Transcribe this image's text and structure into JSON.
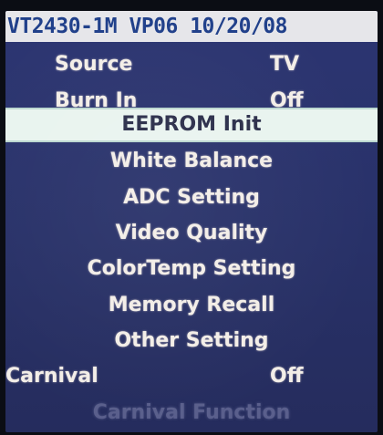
{
  "header": {
    "title": "VT2430-1M VP06 10/20/08"
  },
  "menu": {
    "source": {
      "label": "Source",
      "value": "TV"
    },
    "burn_in": {
      "label": "Burn In",
      "value": "Off"
    },
    "items": [
      "EEPROM Init",
      "White Balance",
      "ADC Setting",
      "Video Quality",
      "ColorTemp Setting",
      "Memory Recall",
      "Other Setting"
    ],
    "carnival": {
      "label": "Carnival",
      "value": "Off"
    },
    "carnival_function": "Carnival Function"
  },
  "colors": {
    "menu_background": "#2a336b",
    "header_background": "#e6e6ea",
    "highlight_background": "#e9f4ef",
    "text": "#f3eee8",
    "disabled_text": "#5a5f8c"
  },
  "selected_item": "EEPROM Init"
}
